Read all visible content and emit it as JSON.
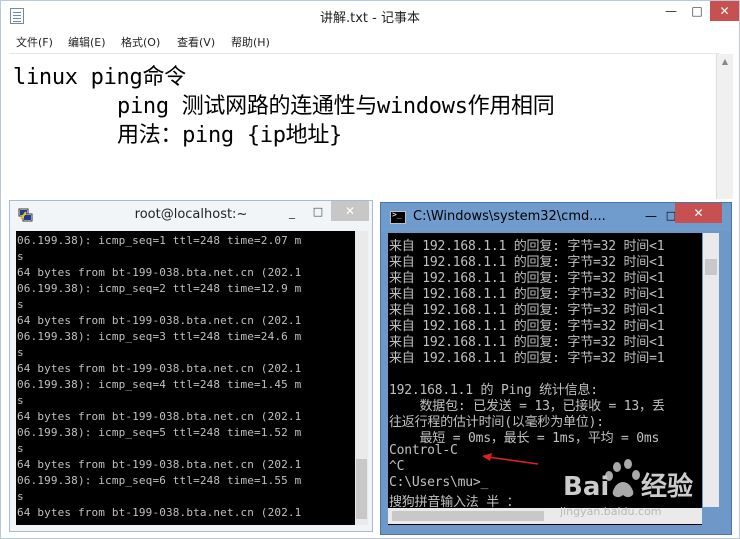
{
  "notepad": {
    "title": "讲解.txt - 记事本",
    "controls": {
      "minimize": "—",
      "maximize": "□",
      "close": "✕"
    },
    "menu": [
      "文件(F)",
      "编辑(E)",
      "格式(O)",
      "查看(V)",
      "帮助(H)"
    ],
    "lines": [
      "linux ping命令",
      "ping 测试网路的连通性与windows作用相同",
      "用法：ping {ip地址}"
    ]
  },
  "putty": {
    "title": "root@localhost:~",
    "controls": {
      "minimize": "_",
      "maximize": "□",
      "close": "✕"
    },
    "lines": [
      "06.199.38): icmp_seq=1 ttl=248 time=2.07 m",
      "s",
      "64 bytes from bt-199-038.bta.net.cn (202.1",
      "06.199.38): icmp_seq=2 ttl=248 time=12.9 m",
      "s",
      "64 bytes from bt-199-038.bta.net.cn (202.1",
      "06.199.38): icmp_seq=3 ttl=248 time=24.6 m",
      "s",
      "64 bytes from bt-199-038.bta.net.cn (202.1",
      "06.199.38): icmp_seq=4 ttl=248 time=1.45 m",
      "s",
      "64 bytes from bt-199-038.bta.net.cn (202.1",
      "06.199.38): icmp_seq=5 ttl=248 time=1.52 m",
      "s",
      "64 bytes from bt-199-038.bta.net.cn (202.1",
      "06.199.38): icmp_seq=6 ttl=248 time=1.55 m",
      "s",
      "64 bytes from bt-199-038.bta.net.cn (202.1"
    ]
  },
  "cmd": {
    "title": "C:\\Windows\\system32\\cmd....",
    "controls": {
      "minimize": "—",
      "maximize": "□",
      "close": "✕"
    },
    "lines": [
      "来自 192.168.1.1 的回复: 字节=32 时间<1",
      "来自 192.168.1.1 的回复: 字节=32 时间<1",
      "来自 192.168.1.1 的回复: 字节=32 时间<1",
      "来自 192.168.1.1 的回复: 字节=32 时间<1",
      "来自 192.168.1.1 的回复: 字节=32 时间<1",
      "来自 192.168.1.1 的回复: 字节=32 时间<1",
      "来自 192.168.1.1 的回复: 字节=32 时间<1",
      "来自 192.168.1.1 的回复: 字节=32 时间=1",
      "",
      "192.168.1.1 的 Ping 统计信息:",
      "    数据包: 已发送 = 13，已接收 = 13，丢",
      "往返行程的估计时间(以毫秒为单位):",
      "    最短 = 0ms，最长 = 1ms，平均 = 0ms",
      "Control-C",
      "^C",
      "C:\\Users\\mu>_",
      "搜狗拼音输入法 半 ："
    ]
  },
  "annotation": {
    "arrow_color": "#e02020"
  },
  "watermark": {
    "logo": "Baidu",
    "caption": "jingyan.baidu.com"
  }
}
